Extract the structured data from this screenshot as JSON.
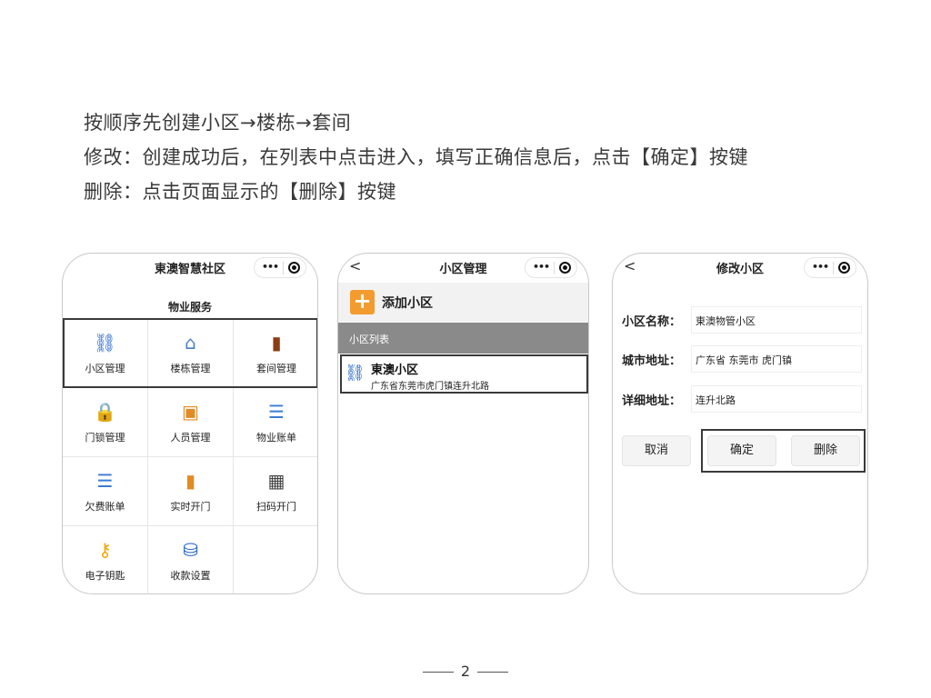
{
  "instructions": [
    "按顺序先创建小区→楼栋→套间",
    "修改：创建成功后，在列表中点击进入，填写正确信息后，点击【确定】按键",
    "删除：点击页面显示的【删除】按键"
  ],
  "phone1": {
    "title": "東澳智慧社区",
    "section": "物业服务",
    "items": [
      {
        "label": "小区管理",
        "icon": "network-icon",
        "glyph": "⛓",
        "color": "#1a5fc9"
      },
      {
        "label": "楼栋管理",
        "icon": "building-gear-icon",
        "glyph": "⌂",
        "color": "#4a7fc1"
      },
      {
        "label": "套间管理",
        "icon": "door-icon",
        "glyph": "▮",
        "color": "#8a3d12"
      },
      {
        "label": "门锁管理",
        "icon": "padlock-icon",
        "glyph": "🔒",
        "color": "#555555"
      },
      {
        "label": "人员管理",
        "icon": "person-card-icon",
        "glyph": "▣",
        "color": "#e08b24"
      },
      {
        "label": "物业账单",
        "icon": "document-icon",
        "glyph": "☰",
        "color": "#3a7bd5"
      },
      {
        "label": "欠费账单",
        "icon": "bill-icon",
        "glyph": "☰",
        "color": "#3a7bd5"
      },
      {
        "label": "实时开门",
        "icon": "open-door-icon",
        "glyph": "▮",
        "color": "#e08b24"
      },
      {
        "label": "扫码开门",
        "icon": "qr-scan-icon",
        "glyph": "▦",
        "color": "#444444"
      },
      {
        "label": "电子钥匙",
        "icon": "key-icon",
        "glyph": "⚷",
        "color": "#f0a500"
      },
      {
        "label": "收款设置",
        "icon": "payment-settings-icon",
        "glyph": "⛁",
        "color": "#1a5fc9"
      }
    ]
  },
  "phone2": {
    "title": "小区管理",
    "back": "<",
    "add_label": "添加小区",
    "list_header": "小区列表",
    "item": {
      "name": "東澳小区",
      "address": "广东省东莞市虎门镇连升北路"
    }
  },
  "phone3": {
    "title": "修改小区",
    "back": "<",
    "fields": [
      {
        "label": "小区名称：",
        "value": "東澳物管小区"
      },
      {
        "label": "城市地址：",
        "value": "广东省 东莞市 虎门镇"
      },
      {
        "label": "详细地址：",
        "value": "连升北路"
      }
    ],
    "cancel": "取消",
    "confirm": "确定",
    "delete": "删除"
  },
  "capsule": {
    "more": "•••"
  },
  "page_number": "2"
}
